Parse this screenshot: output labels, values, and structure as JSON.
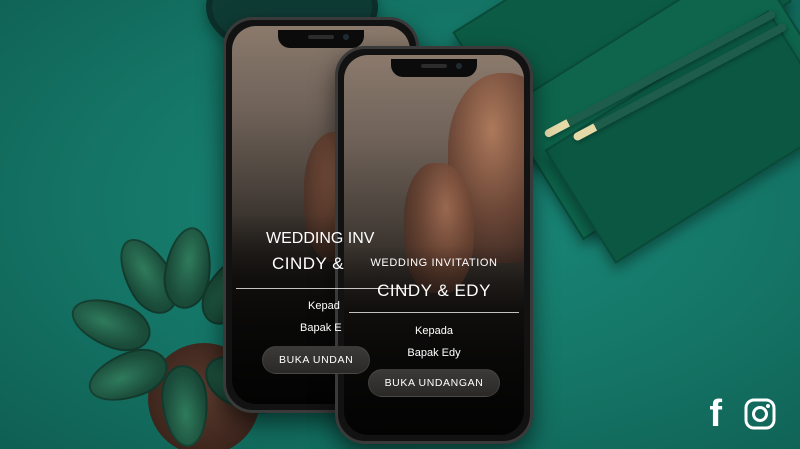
{
  "background": {
    "color": "#147566"
  },
  "phone_back": {
    "heading": "WEDDING INV",
    "couple": "CINDY &",
    "to_label": "Kepad",
    "recipient": "Bapak E",
    "button_label": "BUKA UNDAN"
  },
  "phone_front": {
    "heading": "WEDDING INVITATION",
    "couple": "CINDY & EDY",
    "to_label": "Kepada",
    "recipient": "Bapak Edy",
    "button_label": "BUKA UNDANGAN"
  },
  "social": {
    "facebook": "f",
    "icons": [
      "facebook-icon",
      "instagram-icon"
    ]
  }
}
